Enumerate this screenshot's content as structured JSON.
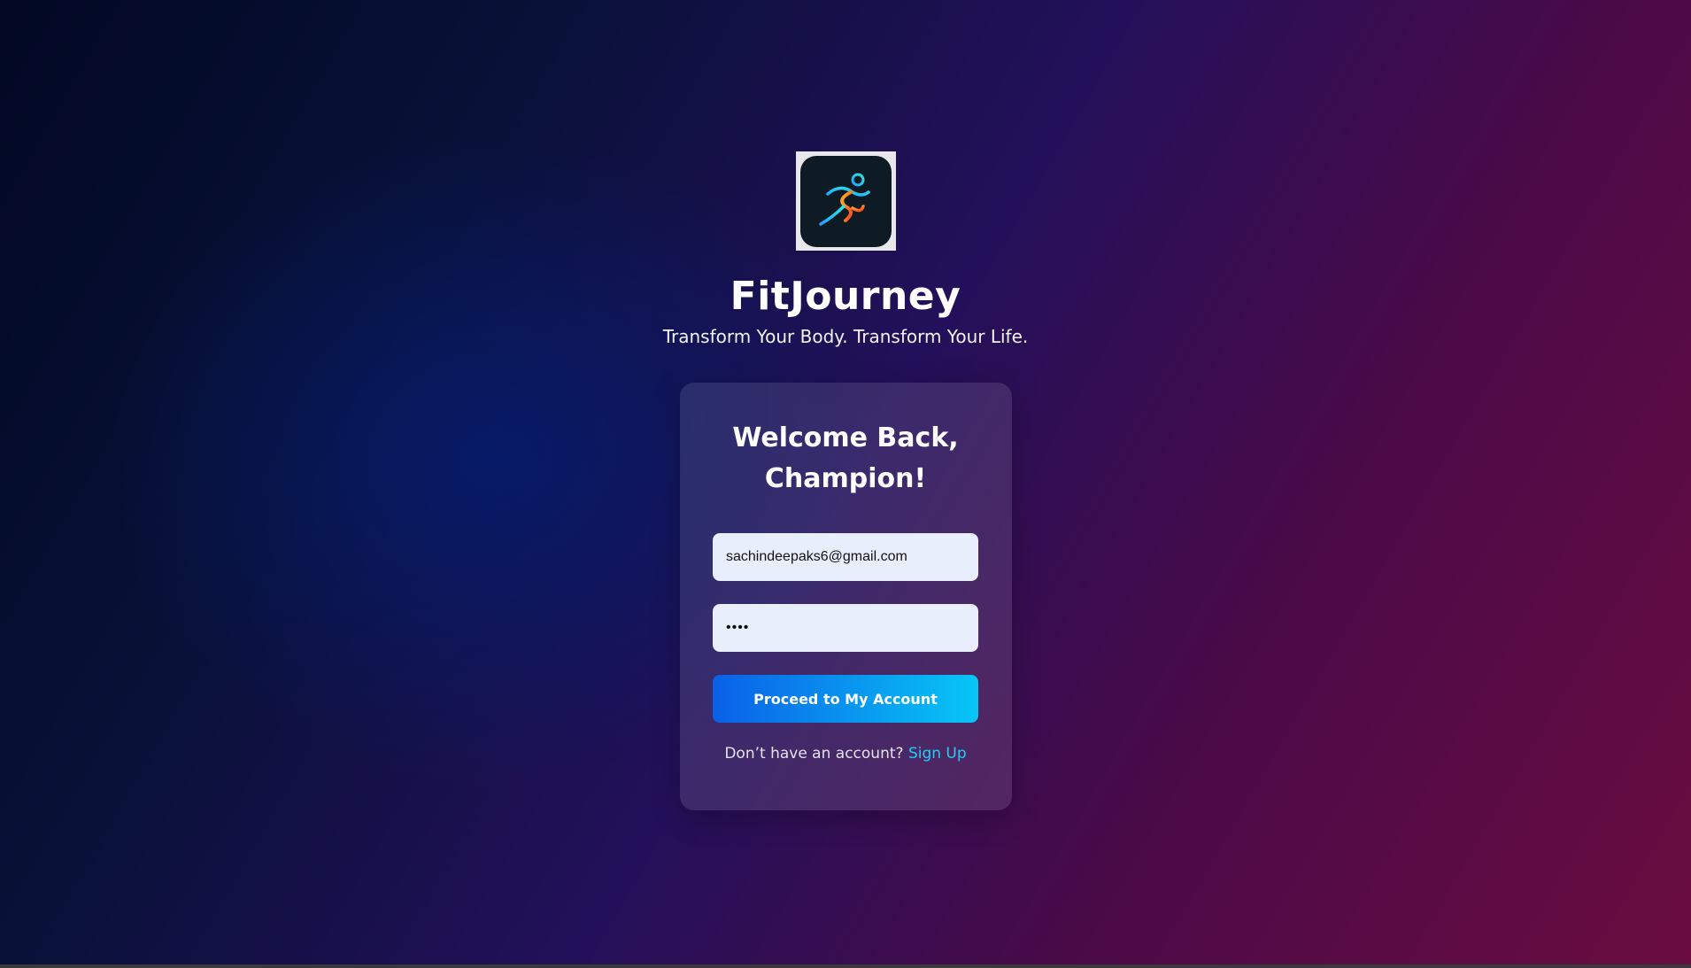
{
  "brand": {
    "app_name": "FitJourney",
    "tagline": "Transform Your Body. Transform Your Life.",
    "logo_icon": "running-person-icon"
  },
  "login_card": {
    "heading": "Welcome Back, Champion!",
    "email": {
      "value": "sachindeepaks6@gmail.com"
    },
    "password": {
      "value": "••••"
    },
    "submit_label": "Proceed to My Account",
    "signup_prompt": "Don’t have an account?",
    "signup_link": "Sign Up"
  },
  "colors": {
    "accent": "#1fd0f5",
    "button_start": "#0a60e8",
    "button_end": "#08c6f6",
    "input_background": "#e8eefc"
  }
}
